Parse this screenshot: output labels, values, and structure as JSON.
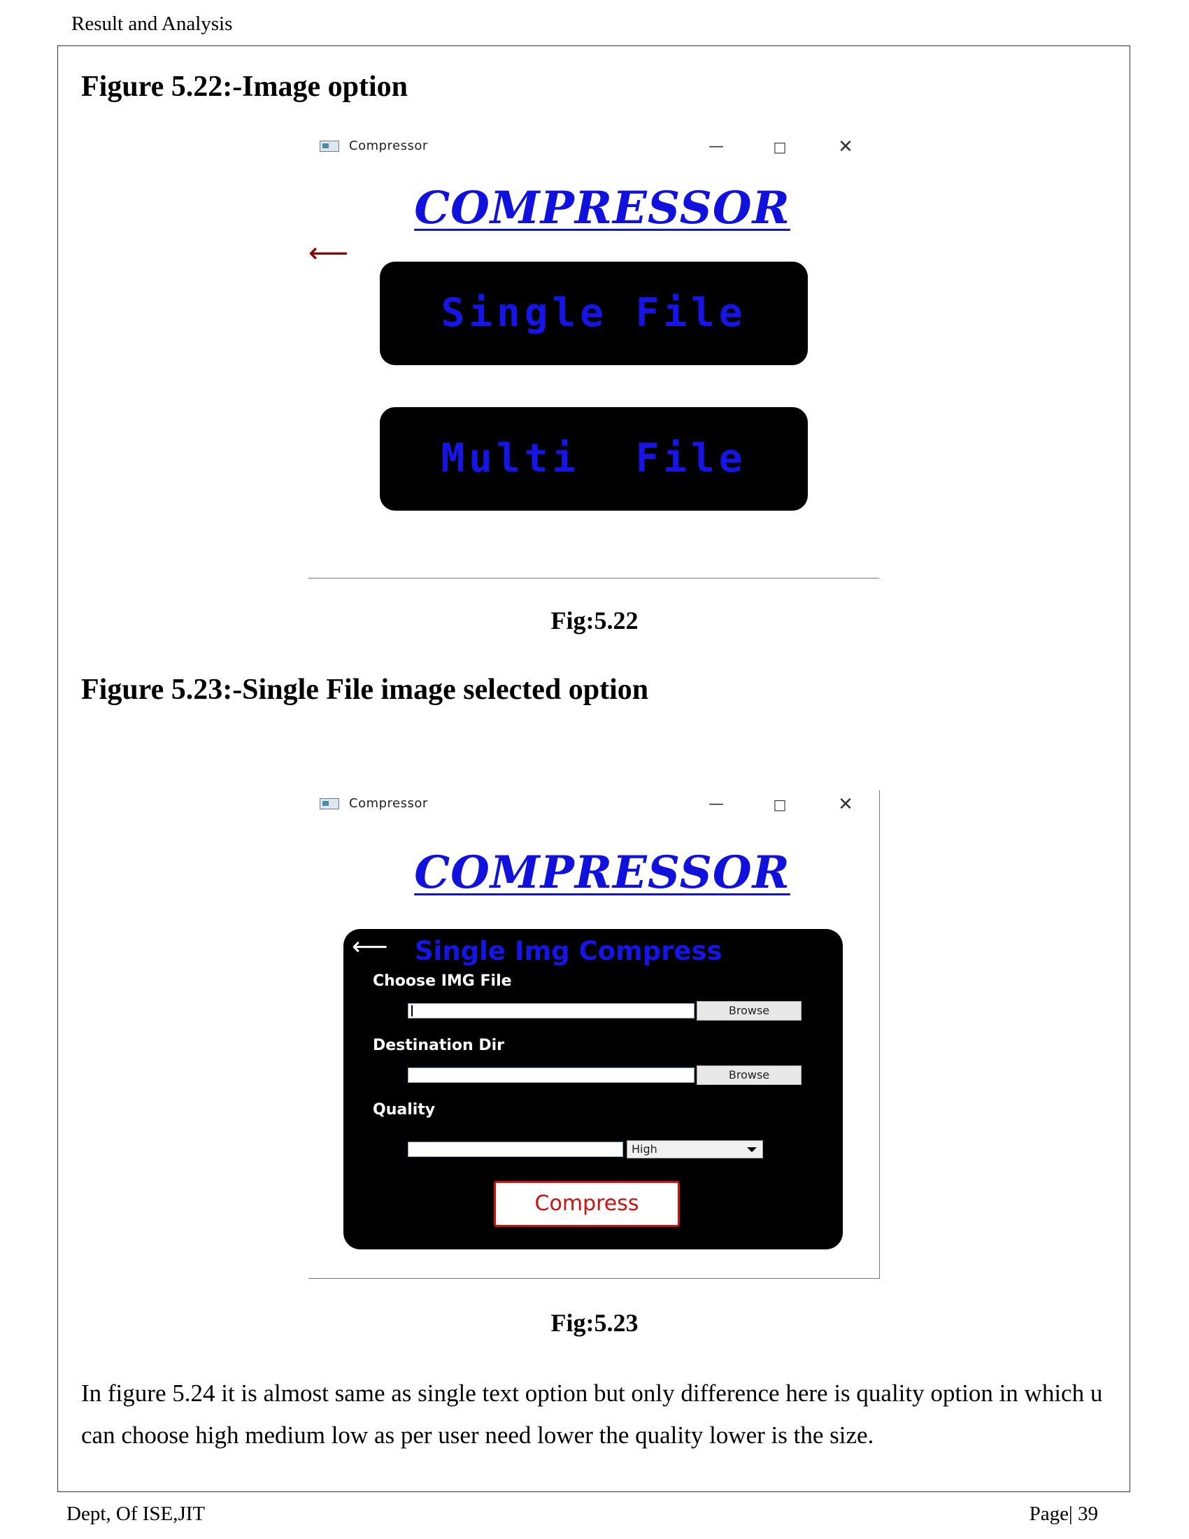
{
  "header": {
    "running_title": "Result and Analysis"
  },
  "figure_22": {
    "heading": "Figure 5.22:-Image option",
    "window": {
      "title": "Compressor",
      "controls": {
        "minimize": "—",
        "maximize": "□",
        "close": "✕"
      },
      "logo_text": "COMPRESSOR",
      "back_arrow": "⟵",
      "buttons": [
        "Single File",
        "Multi  File"
      ]
    },
    "caption": "Fig:5.22"
  },
  "figure_23": {
    "heading": "Figure 5.23:-Single File image selected option",
    "window": {
      "title": "Compressor",
      "controls": {
        "minimize": "—",
        "maximize": "□",
        "close": "✕"
      },
      "logo_text": "COMPRESSOR",
      "panel": {
        "back_arrow": "⟵",
        "title": "Single Img Compress",
        "choose_label": "Choose IMG File",
        "choose_value": "",
        "browse_label": "Browse",
        "dest_label": "Destination Dir",
        "dest_value": "",
        "dest_browse_label": "Browse",
        "quality_label": "Quality",
        "quality_value": "",
        "quality_selected": "High",
        "compress_label": "Compress"
      }
    },
    "caption": "Fig:5.23"
  },
  "body_text": "In figure 5.24 it is almost same as single text option but only difference here is quality option in which u can choose high medium low as per user need lower the quality lower is the size.",
  "footer": {
    "left": "Dept, Of ISE,JIT",
    "right": "Page| 39"
  },
  "colors": {
    "logo": "#1111dd",
    "button_text": "#1515e8",
    "compress_red": "#cc1111",
    "back_arrow": "#8b0000"
  }
}
